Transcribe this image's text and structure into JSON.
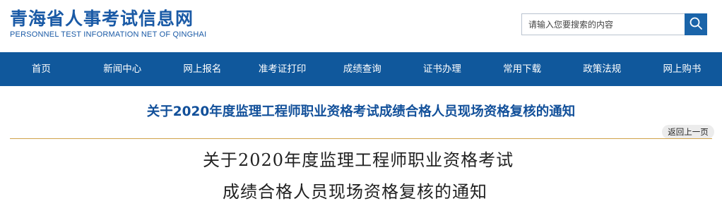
{
  "header": {
    "logo_cn": "青海省人事考试信息网",
    "logo_en": "PERSONNEL TEST INFORMATION NET OF QINGHAI",
    "search_placeholder": "请输入您要搜索的内容",
    "search_icon": "search-icon"
  },
  "nav": {
    "items": [
      {
        "label": "首页"
      },
      {
        "label": "新闻中心"
      },
      {
        "label": "网上报名"
      },
      {
        "label": "准考证打印"
      },
      {
        "label": "成绩查询"
      },
      {
        "label": "证书办理"
      },
      {
        "label": "常用下载"
      },
      {
        "label": "政策法规"
      },
      {
        "label": "网上购书"
      }
    ]
  },
  "article": {
    "title": "关于2020年度监理工程师职业资格考试成绩合格人员现场资格复核的通知",
    "back_label": "返回上一页",
    "doc_heading_line1": "关于2020年度监理工程师职业资格考试",
    "doc_heading_line2": "成绩合格人员现场资格复核的通知"
  },
  "colors": {
    "brand": "#1a5aa6",
    "nav_bg": "#10589c",
    "divider": "#d0a24a"
  }
}
